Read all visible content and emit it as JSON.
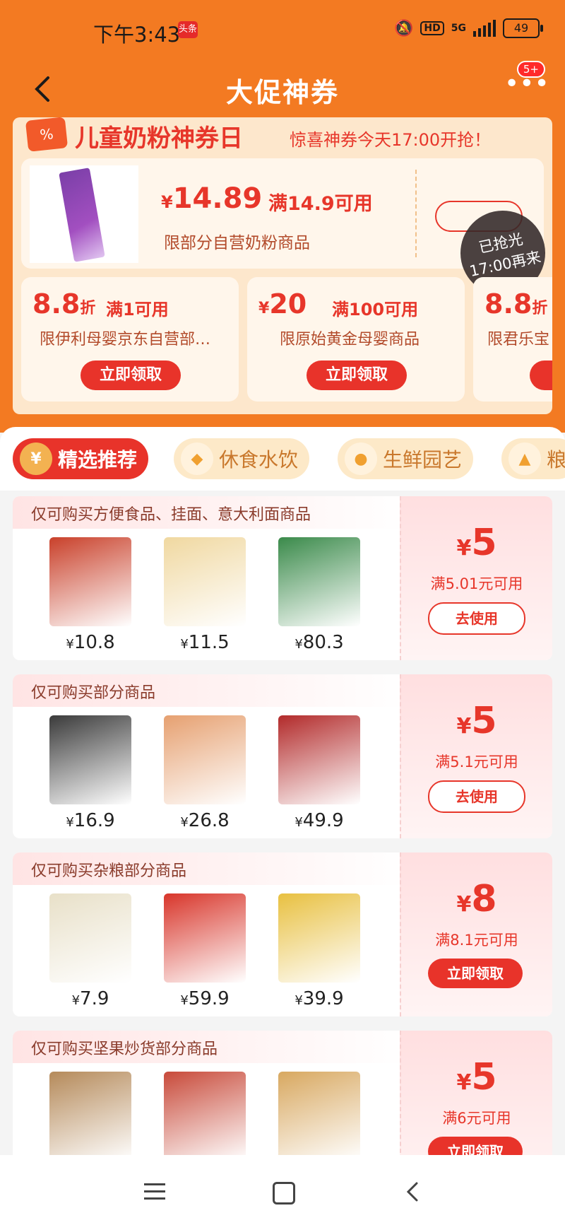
{
  "status": {
    "time": "下午3:43",
    "app_tag": "头条",
    "network": "5G",
    "battery": "49"
  },
  "nav": {
    "title": "大促神券",
    "badge": "5+"
  },
  "promo": {
    "title": "儿童奶粉神券日",
    "note": "惊喜神券今天17:00开抢！",
    "main_coupon": {
      "currency": "¥",
      "amount": "14.89",
      "condition": "满14.9可用",
      "desc": "限部分自营奶粉商品",
      "sold_out_line1": "已抢光",
      "sold_out_line2": "17:00再来"
    },
    "coupons": [
      {
        "value": "8.8",
        "unit": "折",
        "prefix": "",
        "condition": "满1可用",
        "desc": "限伊利母婴京东自营部…",
        "button": "立即领取"
      },
      {
        "value": "20",
        "unit": "",
        "prefix": "¥",
        "condition": "满100可用",
        "desc": "限原始黄金母婴商品",
        "button": "立即领取"
      },
      {
        "value": "8.8",
        "unit": "折",
        "prefix": "",
        "condition": "",
        "desc": "限君乐宝",
        "button": "立"
      }
    ]
  },
  "tabs": [
    {
      "label": "精选推荐",
      "icon": "¥",
      "active": true
    },
    {
      "label": "休食水饮",
      "icon": "◆",
      "active": false
    },
    {
      "label": "生鲜园艺",
      "icon": "●",
      "active": false
    },
    {
      "label": "粮",
      "icon": "▲",
      "active": false
    }
  ],
  "cards": [
    {
      "title": "仅可购买方便食品、挂面、意大利面商品",
      "products": [
        {
          "price": "10.8",
          "color": "#c9402a"
        },
        {
          "price": "11.5",
          "color": "#f0d8a0"
        },
        {
          "price": "80.3",
          "color": "#3a8a4a"
        }
      ],
      "value": "5",
      "condition": "满5.01元可用",
      "button": "去使用",
      "button_style": "outline"
    },
    {
      "title": "仅可购买部分商品",
      "products": [
        {
          "price": "16.9",
          "color": "#3a3a3a"
        },
        {
          "price": "26.8",
          "color": "#e6a070"
        },
        {
          "price": "49.9",
          "color": "#b22a2a"
        }
      ],
      "value": "5",
      "condition": "满5.1元可用",
      "button": "去使用",
      "button_style": "outline"
    },
    {
      "title": "仅可购买杂粮部分商品",
      "products": [
        {
          "price": "7.9",
          "color": "#e8e0c8"
        },
        {
          "price": "59.9",
          "color": "#d8352a"
        },
        {
          "price": "39.9",
          "color": "#e8c040"
        }
      ],
      "value": "8",
      "condition": "满8.1元可用",
      "button": "立即领取",
      "button_style": "solid"
    },
    {
      "title": "仅可购买坚果炒货部分商品",
      "products": [
        {
          "price": "",
          "color": "#b58a5a"
        },
        {
          "price": "",
          "color": "#c84a3a"
        },
        {
          "price": "",
          "color": "#d8a860"
        }
      ],
      "value": "5",
      "condition": "满6元可用",
      "button": "立即领取",
      "button_style": "solid"
    }
  ]
}
